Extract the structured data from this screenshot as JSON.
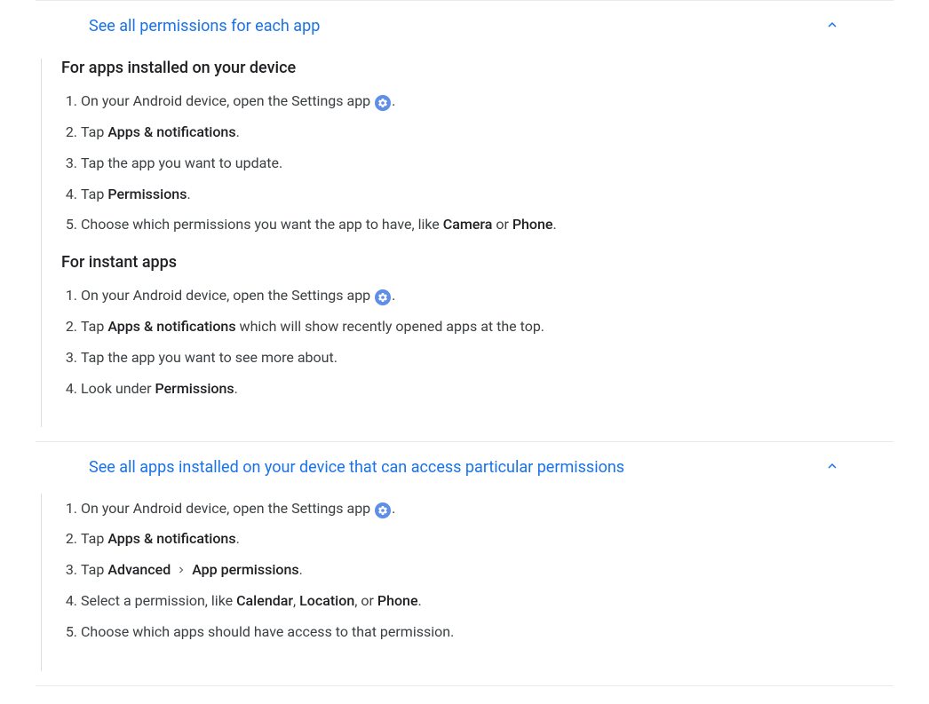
{
  "sections": [
    {
      "title": "See all permissions for each app",
      "parts": [
        {
          "heading": "For apps installed on your device",
          "steps": [
            {
              "pre": "On your Android device, open the Settings app ",
              "icon": "settings",
              "post": "."
            },
            {
              "pre": "Tap ",
              "bold1": "Apps & notifications",
              "mid": ".",
              "post": ""
            },
            {
              "pre": "Tap the app you want to update."
            },
            {
              "pre": "Tap ",
              "bold1": "Permissions",
              "mid": ".",
              "post": ""
            },
            {
              "pre": "Choose which permissions you want the app to have, like ",
              "bold1": "Camera",
              "mid": " or ",
              "bold2": "Phone",
              "post": "."
            }
          ]
        },
        {
          "heading": "For instant apps",
          "steps": [
            {
              "pre": "On your Android device, open the Settings app ",
              "icon": "settings",
              "post": "."
            },
            {
              "pre": "Tap ",
              "bold1": "Apps & notifications",
              "mid": " which will show recently opened apps at the top.",
              "post": ""
            },
            {
              "pre": "Tap the app you want to see more about."
            },
            {
              "pre": "Look under ",
              "bold1": "Permissions",
              "mid": ".",
              "post": ""
            }
          ]
        }
      ]
    },
    {
      "title": "See all apps installed on your device that can access particular permissions",
      "parts": [
        {
          "heading": null,
          "steps": [
            {
              "pre": "On your Android device, open the Settings app ",
              "icon": "settings",
              "post": "."
            },
            {
              "pre": "Tap ",
              "bold1": "Apps & notifications",
              "mid": ".",
              "post": ""
            },
            {
              "pre": "Tap ",
              "bold1": "Advanced",
              "mid": " ",
              "caret": true,
              "mid2": " ",
              "bold2": "App permissions",
              "post": "."
            },
            {
              "pre": "Select a permission, like ",
              "bold1": "Calendar",
              "mid": ", ",
              "bold2": "Location",
              "mid2": ", or ",
              "bold3": "Phone",
              "post": "."
            },
            {
              "pre": "Choose which apps should have access to that permission."
            }
          ]
        }
      ]
    }
  ]
}
